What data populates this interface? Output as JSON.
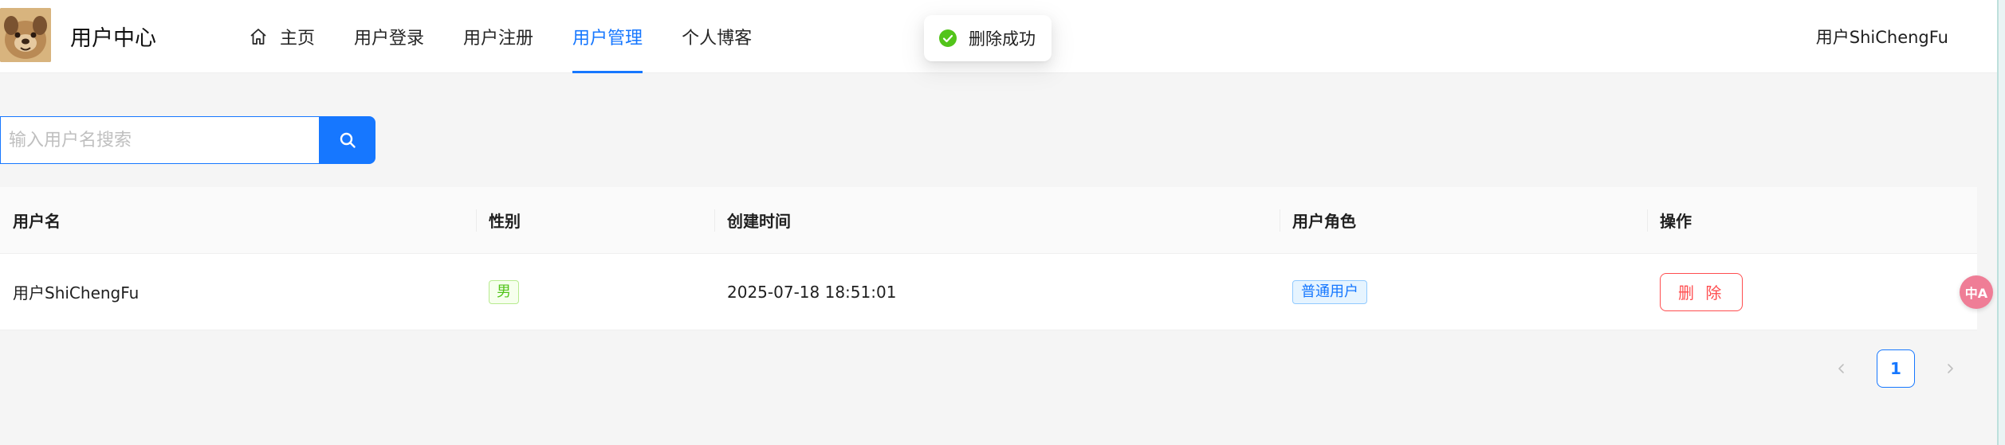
{
  "header": {
    "site_title": "用户中心",
    "logo_icon": "dog-avatar-logo",
    "nav": [
      {
        "label": "主页",
        "icon": "home-icon",
        "active": false
      },
      {
        "label": "用户登录",
        "active": false
      },
      {
        "label": "用户注册",
        "active": false
      },
      {
        "label": "用户管理",
        "active": true
      },
      {
        "label": "个人博客",
        "active": false
      }
    ],
    "current_user": "用户ShiChengFu"
  },
  "toast": {
    "message": "删除成功",
    "icon": "check-circle-icon",
    "color": "#52c41a"
  },
  "search": {
    "placeholder": "输入用户名搜索",
    "value": "",
    "button_icon": "search-icon"
  },
  "table": {
    "columns": [
      "用户名",
      "性别",
      "创建时间",
      "用户角色",
      "操作"
    ],
    "rows": [
      {
        "username": "用户ShiChengFu",
        "gender": "男",
        "created_at": "2025-07-18 18:51:01",
        "role": "普通用户",
        "action": "删 除"
      }
    ]
  },
  "pagination": {
    "current_page": "1",
    "prev_icon": "chevron-left-icon",
    "next_icon": "chevron-right-icon"
  },
  "floating_button": {
    "label": "中A",
    "icon": "translate-icon"
  },
  "colors": {
    "primary": "#1677ff",
    "danger": "#ff4d4f",
    "success": "#52c41a"
  }
}
